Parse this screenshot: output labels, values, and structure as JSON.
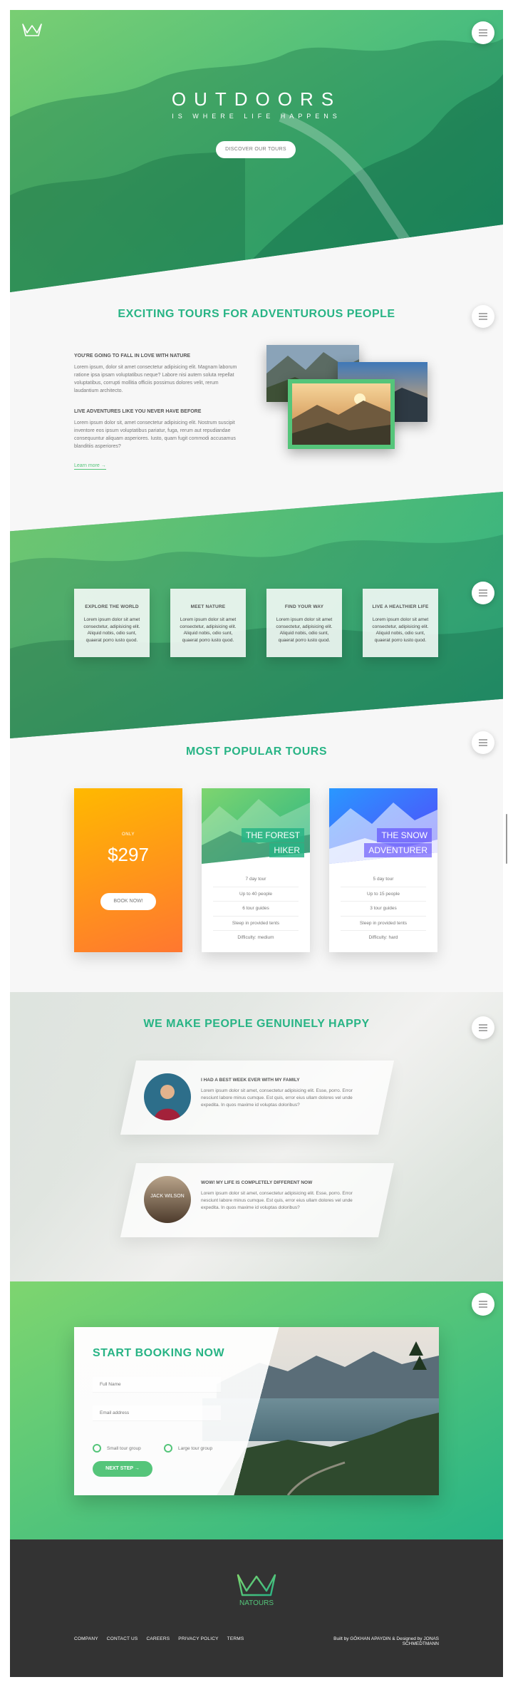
{
  "hero": {
    "title": "OUTDOORS",
    "subtitle": "IS WHERE LIFE HAPPENS",
    "cta": "DISCOVER OUR TOURS"
  },
  "about": {
    "title": "EXCITING TOURS FOR ADVENTUROUS PEOPLE",
    "heading1": "YOU'RE GOING TO FALL IN LOVE WITH NATURE",
    "text1": "Lorem ipsum, dolor sit amet consectetur adipisicing elit. Magnam laborum ratione ipsa ipsam voluptatibus neque? Labore nisi autem soluta repellat voluptatibus, corrupti mollitia officiis possimus dolores velit, rerum laudantium architecto.",
    "heading2": "LIVE ADVENTURES LIKE YOU NEVER HAVE BEFORE",
    "text2": "Lorem ipsum dolor sit, amet consectetur adipisicing elit. Nostrum suscipit inventore eos ipsum voluptatibus pariatur, fuga, rerum aut repudiandae consequuntur aliquam asperiores. Iusto, quam fugit commodi accusamus blanditiis asperiores?",
    "learn_more": "Learn more →"
  },
  "features": [
    {
      "title": "EXPLORE THE WORLD",
      "text": "Lorem ipsum dolor sit amet consectetur, adipisicing elit. Aliquid nobis, odio sunt, quaerat porro iusto quod."
    },
    {
      "title": "MEET NATURE",
      "text": "Lorem ipsum dolor sit amet consectetur, adipisicing elit. Aliquid nobis, odio sunt, quaerat porro iusto quod."
    },
    {
      "title": "FIND YOUR WAY",
      "text": "Lorem ipsum dolor sit amet consectetur, adipisicing elit. Aliquid nobis, odio sunt, quaerat porro iusto quod."
    },
    {
      "title": "LIVE A HEALTHIER LIFE",
      "text": "Lorem ipsum dolor sit amet consectetur, adipisicing elit. Aliquid nobis, odio sunt, quaerat porro iusto quod."
    }
  ],
  "tours": {
    "title": "MOST POPULAR TOURS",
    "price_card": {
      "only": "ONLY",
      "price": "$297",
      "button": "BOOK NOW!"
    },
    "cards": [
      {
        "heading_line1": "THE FOREST",
        "heading_line2": "HIKER",
        "details": [
          "7 day tour",
          "Up to 40 people",
          "6 tour guides",
          "Sleep in provided tents",
          "Difficulty: medium"
        ]
      },
      {
        "heading_line1": "THE SNOW",
        "heading_line2": "ADVENTURER",
        "details": [
          "5 day tour",
          "Up to 15 people",
          "3 tour guides",
          "Sleep in provided tents",
          "Difficulty: hard"
        ]
      }
    ]
  },
  "stories": {
    "title": "WE MAKE PEOPLE GENUINELY HAPPY",
    "items": [
      {
        "heading": "I HAD A BEST WEEK EVER WITH MY FAMILY",
        "text": "Lorem ipsum dolor sit amet, consectetur adipisicing elit. Esse, porro. Error nesciunt labore minus cumque. Est quis, error eius ullam dolores vel unde expedita. In quos maxime id voluptas doloribus?",
        "avatar_label": ""
      },
      {
        "heading": "WOW! MY LIFE IS COMPLETELY DIFFERENT NOW",
        "text": "Lorem ipsum dolor sit amet, consectetur adipisicing elit. Esse, porro. Error nesciunt labore minus cumque. Est quis, error eius ullam dolores vel unde expedita. In quos maxime id voluptas doloribus?",
        "avatar_label": "JACK WILSON"
      }
    ]
  },
  "booking": {
    "title": "START BOOKING NOW",
    "full_name_placeholder": "Full Name",
    "email_placeholder": "Email address",
    "radio_small": "Small tour group",
    "radio_large": "Large tour group",
    "next": "NEXT STEP →"
  },
  "footer": {
    "brand": "NATOURS",
    "nav": [
      "COMPANY",
      "CONTACT US",
      "CAREERS",
      "PRIVACY POLICY",
      "TERMS"
    ],
    "credit": "Built by GÖKHAN APAYDIN & Designed by JONAS SCHMEDTMANN"
  },
  "colors": {
    "primary": "#55c57a",
    "primary_dark": "#28b485",
    "orange": "#ff7730",
    "footer_bg": "#333333"
  },
  "icons": [
    "crown-logo-icon",
    "menu-icon"
  ]
}
